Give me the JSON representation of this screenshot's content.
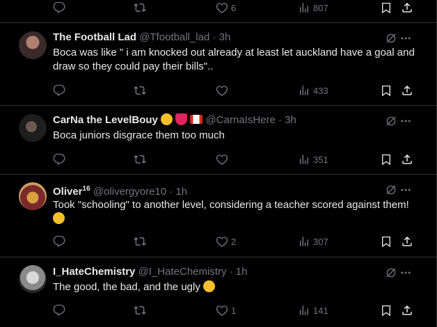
{
  "top_actions": {
    "like_count": "6",
    "views_count": "807"
  },
  "tweets": [
    {
      "name": "The Football Lad",
      "handle": "@Tfootball_lad",
      "dot": "·",
      "time": "3h",
      "text": "Boca was like \" i am knocked out already at least let auckland have a goal and draw so they could pay their bills\"..",
      "like_count": "",
      "views_count": "433"
    },
    {
      "name": "CarNa the LevelBouy",
      "handle": "@CarnaIsHere",
      "dot": "·",
      "time": "3h",
      "text": "Boca juniors disgrace them too much",
      "like_count": "",
      "views_count": "351"
    },
    {
      "name": "Oliver",
      "name_sup": "16",
      "handle": "@olivergyore10",
      "dot": "·",
      "time": "1h",
      "text": "Took \"schooling\" to another level, considering a teacher scored against them!",
      "like_count": "2",
      "views_count": "307"
    },
    {
      "name": "I_HateChemistry",
      "handle": "@I_HateChemistry",
      "dot": "·",
      "time": "1h",
      "text": "The good, the bad, and the ugly",
      "like_count": "1",
      "views_count": "141"
    }
  ],
  "icons": [
    "reply-icon",
    "retweet-icon",
    "like-icon",
    "views-icon",
    "bookmark-icon",
    "share-icon",
    "grok-icon",
    "more-icon"
  ],
  "colors": {
    "background": "#000000",
    "text": "#e7e9ea",
    "muted": "#71767b",
    "border": "#2f3336"
  }
}
